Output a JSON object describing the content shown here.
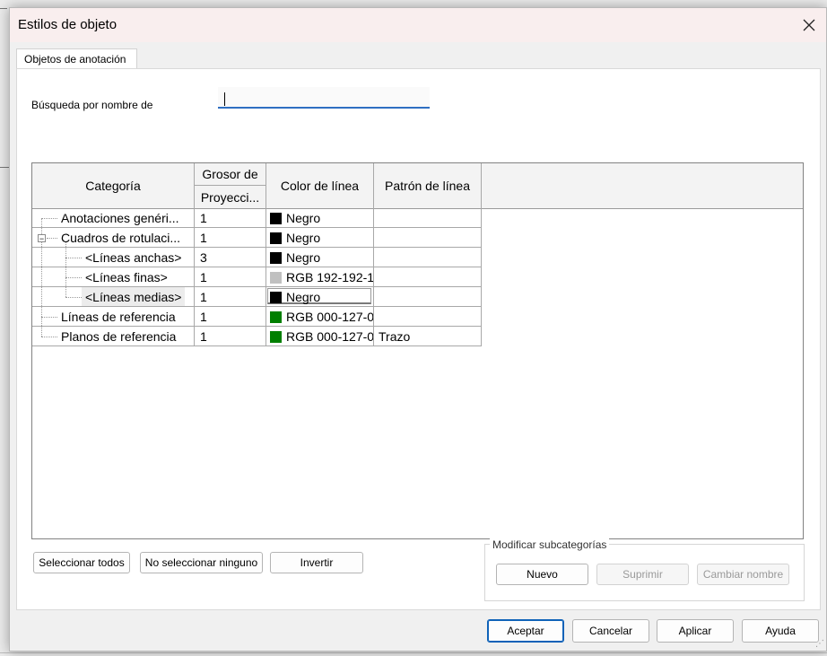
{
  "dialog": {
    "title": "Estilos de objeto",
    "tab": "Objetos de anotación"
  },
  "search": {
    "label": "Búsqueda por nombre de",
    "value": ""
  },
  "grid": {
    "headers": {
      "category": "Categoría",
      "weight_top": "Grosor de",
      "weight_sub": "Proyecci...",
      "color": "Color de línea",
      "pattern": "Patrón de línea"
    },
    "rows": [
      {
        "category": "Anotaciones genéri...",
        "weight": "1",
        "color_name": "Negro",
        "swatch": "#000000",
        "pattern": ""
      },
      {
        "category": "Cuadros de rotulaci...",
        "weight": "1",
        "color_name": "Negro",
        "swatch": "#000000",
        "pattern": ""
      },
      {
        "category": "<Líneas anchas>",
        "weight": "3",
        "color_name": "Negro",
        "swatch": "#000000",
        "pattern": ""
      },
      {
        "category": "<Líneas finas>",
        "weight": "1",
        "color_name": "RGB 192-192-1",
        "swatch": "#c0c0c0",
        "pattern": ""
      },
      {
        "category": "<Líneas medias>",
        "weight": "1",
        "color_name": "Negro",
        "swatch": "#000000",
        "pattern": ""
      },
      {
        "category": "Líneas de referencia",
        "weight": "1",
        "color_name": "RGB 000-127-0",
        "swatch": "#007f00",
        "pattern": ""
      },
      {
        "category": "Planos de referencia",
        "weight": "1",
        "color_name": "RGB 000-127-0",
        "swatch": "#007f00",
        "pattern": "Trazo"
      }
    ]
  },
  "selection_buttons": {
    "select_all": "Seleccionar todos",
    "select_none": "No seleccionar ninguno",
    "invert": "Invertir"
  },
  "subcategories": {
    "title": "Modificar subcategorías",
    "new": "Nuevo",
    "delete": "Suprimir",
    "rename": "Cambiar nombre"
  },
  "footer": {
    "ok": "Aceptar",
    "cancel": "Cancelar",
    "apply": "Aplicar",
    "help": "Ayuda"
  },
  "colors": {
    "accent": "#0f62b8",
    "titlebar": "#f9eeee"
  }
}
